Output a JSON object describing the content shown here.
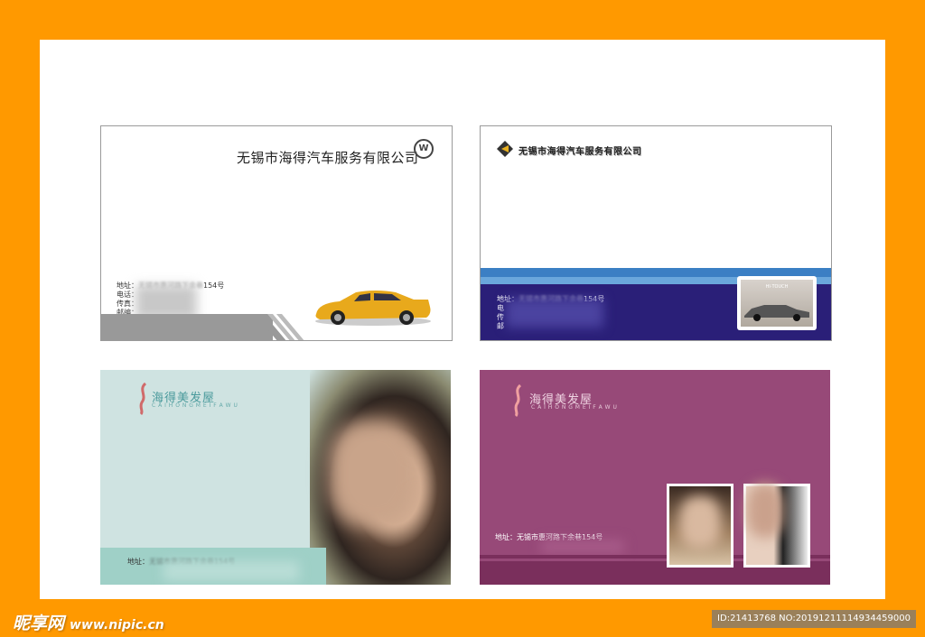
{
  "colors": {
    "frame": "#ff9900",
    "sheet": "#ffffff",
    "card2_band": "#2a1f78",
    "card3_bg": "#cfe3e1",
    "card4_bg": "#974978"
  },
  "card1": {
    "company": "无锡市海得汽车服务有限公司",
    "logo_icon": "volkswagen-logo",
    "info_lines": [
      "地址：",
      "电话：",
      "传真：",
      "邮编："
    ],
    "address_tail": "154号",
    "image_icon": "yellow-sports-car"
  },
  "card2": {
    "company": "无锡市海得汽车服务有限公司",
    "address_prefix": "地址：",
    "address_tail": "154号",
    "info_lines": [
      "电",
      "传",
      "邮"
    ],
    "photo_caption": "HI·TOUCH",
    "image_icon": "sedan-car-photo"
  },
  "card3": {
    "brand": "海得美发屋",
    "brand_sub": "C A I H O N G M E I F A W U",
    "address_label": "地址：",
    "image_icon": "curly-hair-woman-photo"
  },
  "card4": {
    "brand": "海得美发屋",
    "brand_sub": "C A I H O N G M E I F A W U",
    "address_label": "地址：",
    "address_text": "无锡市惠河路下余巷154号",
    "image_icon": "hair-model-photos"
  },
  "watermark": {
    "site_name": "昵享网",
    "site_url": "www.nipic.cn",
    "id_text": "ID:21413768 NO:20191211114934459000"
  }
}
